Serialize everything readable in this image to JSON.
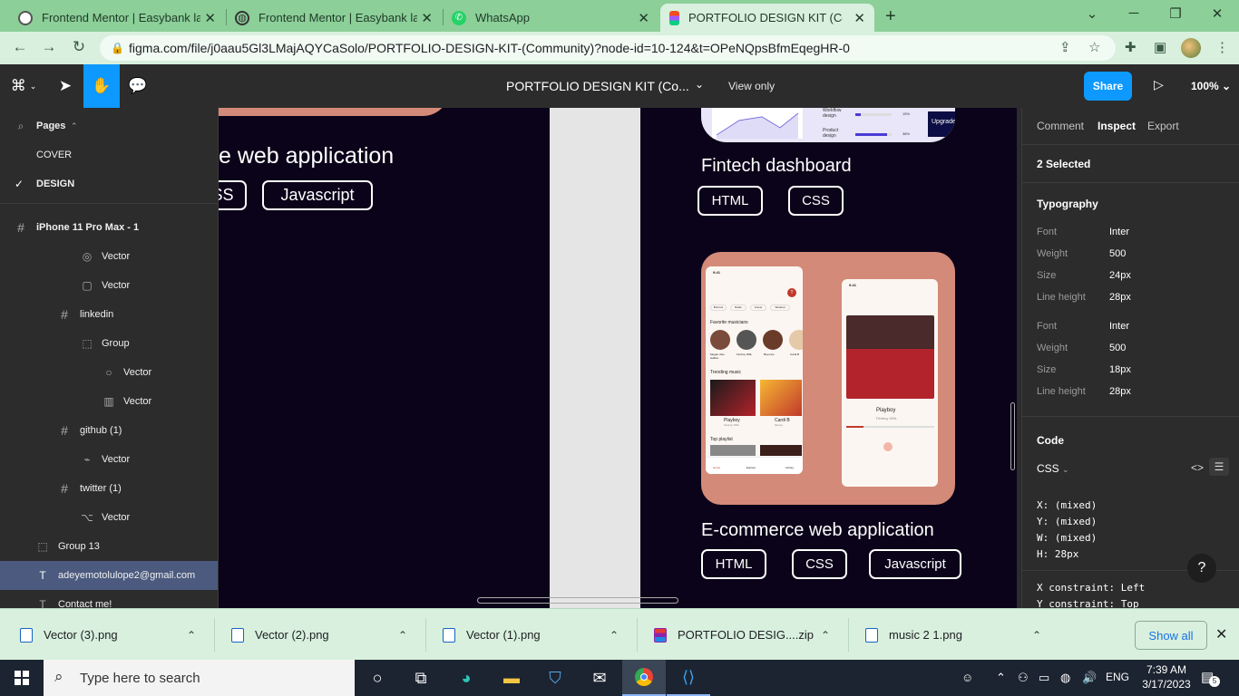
{
  "browser": {
    "tabs": [
      {
        "title": "Frontend Mentor | Easybank landi",
        "icon": "frontend-mentor-icon"
      },
      {
        "title": "Frontend Mentor | Easybank landi",
        "icon": "globe-icon"
      },
      {
        "title": "WhatsApp",
        "icon": "whatsapp-icon"
      },
      {
        "title": "PORTFOLIO DESIGN KIT (Commu",
        "icon": "figma-icon"
      }
    ],
    "url": "figma.com/file/j0aau5Gl3LMajAQYCaSolo/PORTFOLIO-DESIGN-KIT-(Community)?node-id=10-124&t=OPeNQpsBfmEqegHR-0"
  },
  "figma": {
    "file_title": "PORTFOLIO DESIGN KIT (Co...",
    "view_only": "View only",
    "share_label": "Share",
    "zoom": "100%"
  },
  "left_panel": {
    "pages_label": "Pages",
    "pages": [
      {
        "label": "COVER"
      },
      {
        "label": "DESIGN",
        "checked": true
      }
    ],
    "layers": [
      {
        "label": "iPhone 11 Pro Max - 1",
        "icon": "frame-icon"
      },
      {
        "label": "Vector",
        "icon": "vector-icon"
      },
      {
        "label": "Vector",
        "icon": "vector-icon"
      },
      {
        "label": "linkedin",
        "icon": "frame-icon"
      },
      {
        "label": "Group",
        "icon": "group-icon"
      },
      {
        "label": "Vector",
        "icon": "ellipse-icon"
      },
      {
        "label": "Vector",
        "icon": "vector-icon"
      },
      {
        "label": "github (1)",
        "icon": "frame-icon"
      },
      {
        "label": "Vector",
        "icon": "vector-icon"
      },
      {
        "label": "twitter (1)",
        "icon": "frame-icon"
      },
      {
        "label": "Vector",
        "icon": "vector-icon"
      },
      {
        "label": "Group 13",
        "icon": "group-icon"
      },
      {
        "label": "adeyemotolulope2@gmail.com",
        "icon": "text-icon",
        "selected": true
      },
      {
        "label": "Contact me!",
        "icon": "text-icon"
      }
    ]
  },
  "canvas": {
    "left_project_title": "e web application",
    "left_tags": [
      "SS",
      "Javascript"
    ],
    "fintech_title": "Fintech dashboard",
    "fintech_tags": [
      "HTML",
      "CSS"
    ],
    "fintech_mini": {
      "workflow": "Workflow design",
      "product": "Product design",
      "upgrade": "Upgrade",
      "pct1": "15%",
      "pct2": "38%"
    },
    "ecommerce_title": "E-commerce web application",
    "ecommerce_tags": [
      "HTML",
      "CSS",
      "Javascript"
    ],
    "music_app": {
      "time": "9:41",
      "chips": [
        "Bunmoi",
        "Relax",
        "Focus",
        "Workout"
      ],
      "favorite_musicians": "Favorite musicians",
      "musicians": [
        "Megan thee stallion",
        "Fireboy DML",
        "Beyonce",
        "Cardi B"
      ],
      "trending": "Trending music",
      "trending_items": [
        {
          "title": "Playboy",
          "artist": "Fireboy DML"
        },
        {
          "title": "Cardi B",
          "artist": "Money"
        }
      ],
      "top_playlist": "Top playlist",
      "nav": [
        "Home",
        "Explore",
        "Library"
      ],
      "player_title": "Playboy",
      "player_artist": "Fireboy DML"
    }
  },
  "right_panel": {
    "tabs": [
      "Comment",
      "Inspect",
      "Export"
    ],
    "selected_count": "2 Selected",
    "typography_label": "Typography",
    "typography": [
      {
        "font": "Inter",
        "weight": "500",
        "size": "24px",
        "line_height": "28px"
      },
      {
        "font": "Inter",
        "weight": "500",
        "size": "18px",
        "line_height": "28px"
      }
    ],
    "labels": {
      "font": "Font",
      "weight": "Weight",
      "size": "Size",
      "line_height": "Line height"
    },
    "code_label": "Code",
    "code_lang": "CSS",
    "code_lines": [
      "X: (mixed)",
      "Y: (mixed)",
      "W: (mixed)",
      "H: 28px"
    ],
    "constraints": [
      "X constraint: Left",
      "Y constraint: Top"
    ],
    "help": "?"
  },
  "downloads": {
    "items": [
      "Vector (3).png",
      "Vector (2).png",
      "Vector (1).png",
      "PORTFOLIO DESIG....zip",
      "music 2 1.png"
    ],
    "show_all": "Show all"
  },
  "taskbar": {
    "search_placeholder": "Type here to search",
    "lang": "ENG",
    "time": "7:39 AM",
    "date": "3/17/2023",
    "notif_count": "5"
  }
}
